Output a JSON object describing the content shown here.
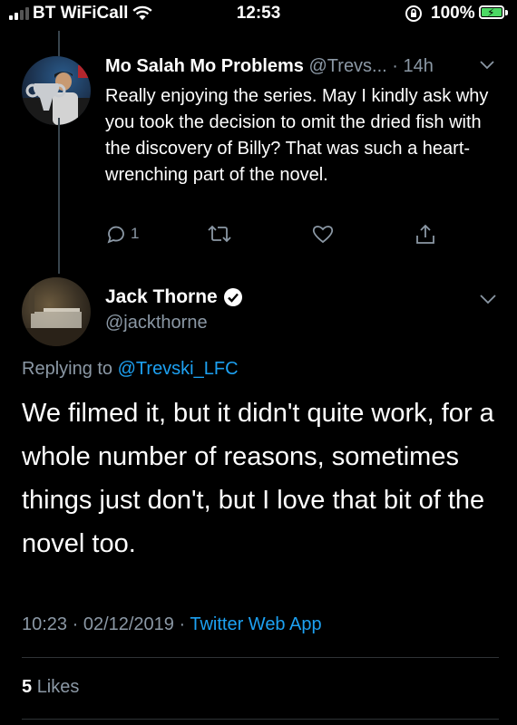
{
  "status_bar": {
    "carrier": "BT WiFiCall",
    "time": "12:53",
    "battery": "100%"
  },
  "parent_tweet": {
    "name": "Mo Salah Mo Problems",
    "handle": "@Trevs...",
    "separator": "·",
    "time": "14h",
    "body": "Really enjoying the series. May I kindly ask why you took the decision to omit the dried fish with the discovery of Billy? That was such a heart-wrenching part of the novel.",
    "reply_count": "1"
  },
  "main_tweet": {
    "name": "Jack Thorne",
    "handle": "@jackthorne",
    "replying_prefix": "Replying to",
    "replying_to": "@Trevski_LFC",
    "body": "We filmed it, but it didn't quite work, for a whole number of reasons, sometimes things just don't, but I love that bit of the novel too.",
    "timestamp": "10:23 · 02/12/2019 ·",
    "source": "Twitter Web App",
    "likes_count": "5",
    "likes_label": "Likes"
  },
  "colors": {
    "background": "#000000",
    "secondary_text": "#8b98a5",
    "link": "#1da1f2"
  }
}
